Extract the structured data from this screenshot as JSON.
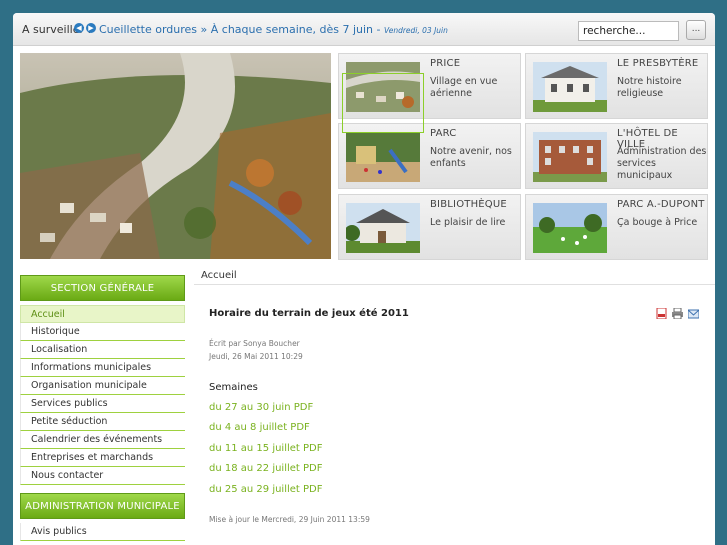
{
  "topbar": {
    "watch_label": "A surveiller :",
    "ticker_text": "Cueillette ordures » À chaque semaine, dès 7 juin",
    "ticker_separator": "-",
    "ticker_date": "Vendredi, 03 Juin",
    "search_value": "recherche...",
    "search_button_label": "..."
  },
  "tiles": [
    {
      "title": "PRICE",
      "desc": "Village en vue aérienne"
    },
    {
      "title": "LE PRESBYTÈRE",
      "desc": "Notre histoire religieuse"
    },
    {
      "title": "PARC",
      "desc": "Notre avenir, nos enfants"
    },
    {
      "title": "L'HÔTEL DE VILLE",
      "desc": "Administration des services municipaux"
    },
    {
      "title": "BIBLIOTHÈQUE",
      "desc": "Le plaisir de lire"
    },
    {
      "title": "PARC A.-DUPONT",
      "desc": "Ça bouge à Price"
    }
  ],
  "sidebar": {
    "section1_title": "SECTION GÉNÉRALE",
    "section1_items": [
      "Accueil",
      "Historique",
      "Localisation",
      "Informations municipales",
      "Organisation municipale",
      "Services publics",
      "Petite séduction",
      "Calendrier des événements",
      "Entreprises et marchands",
      "Nous contacter"
    ],
    "section2_title": "ADMINISTRATION MUNICIPALE",
    "section2_items": [
      "Avis publics"
    ]
  },
  "main": {
    "breadcrumb": "Accueil",
    "article_title": "Horaire du terrain de jeux été 2011",
    "author": "Écrit par Sonya Boucher",
    "date": "Jeudi, 26 Mai 2011 10:29",
    "weeks_heading": "Semaines",
    "week_links": [
      "du 27 au 30 juin PDF",
      "du 4 au 8 juillet PDF",
      "du 11 au 15 juillet PDF",
      "du 18 au 22 juillet PDF",
      "du 25 au 29 juillet PDF"
    ],
    "updated": "Mise à jour le Mercredi, 29 Juin 2011 13:59"
  },
  "icons": [
    "pdf-icon",
    "print-icon",
    "email-icon"
  ],
  "colors": {
    "accent_green": "#7ab21f",
    "link_blue": "#2b6fae",
    "background": "#2f6f86"
  }
}
